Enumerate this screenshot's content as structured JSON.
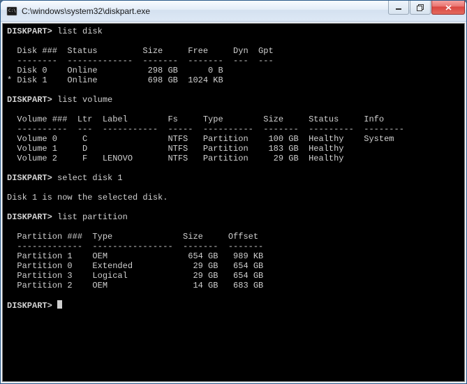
{
  "window": {
    "title": "C:\\windows\\system32\\diskpart.exe"
  },
  "session": {
    "prompt": "DISKPART>",
    "commands": {
      "c1": "list disk",
      "c2": "list volume",
      "c3": "select disk 1",
      "c4": "list partition"
    },
    "select_response": "Disk 1 is now the selected disk."
  },
  "disk_table": {
    "header": "  Disk ###  Status         Size     Free     Dyn  Gpt",
    "rule": "  --------  -------------  -------  -------  ---  ---",
    "rows": [
      "  Disk 0    Online          298 GB      0 B",
      "* Disk 1    Online          698 GB  1024 KB"
    ]
  },
  "volume_table": {
    "header": "  Volume ###  Ltr  Label        Fs     Type        Size     Status     Info",
    "rule": "  ----------  ---  -----------  -----  ----------  -------  ---------  --------",
    "rows": [
      "  Volume 0     C                NTFS   Partition    100 GB  Healthy    System",
      "  Volume 1     D                NTFS   Partition    183 GB  Healthy",
      "  Volume 2     F   LENOVO       NTFS   Partition     29 GB  Healthy"
    ]
  },
  "partition_table": {
    "header": "  Partition ###  Type              Size     Offset",
    "rule": "  -------------  ----------------  -------  -------",
    "rows": [
      "  Partition 1    OEM                654 GB   989 KB",
      "  Partition 0    Extended            29 GB   654 GB",
      "  Partition 3    Logical             29 GB   654 GB",
      "  Partition 2    OEM                 14 GB   683 GB"
    ]
  }
}
